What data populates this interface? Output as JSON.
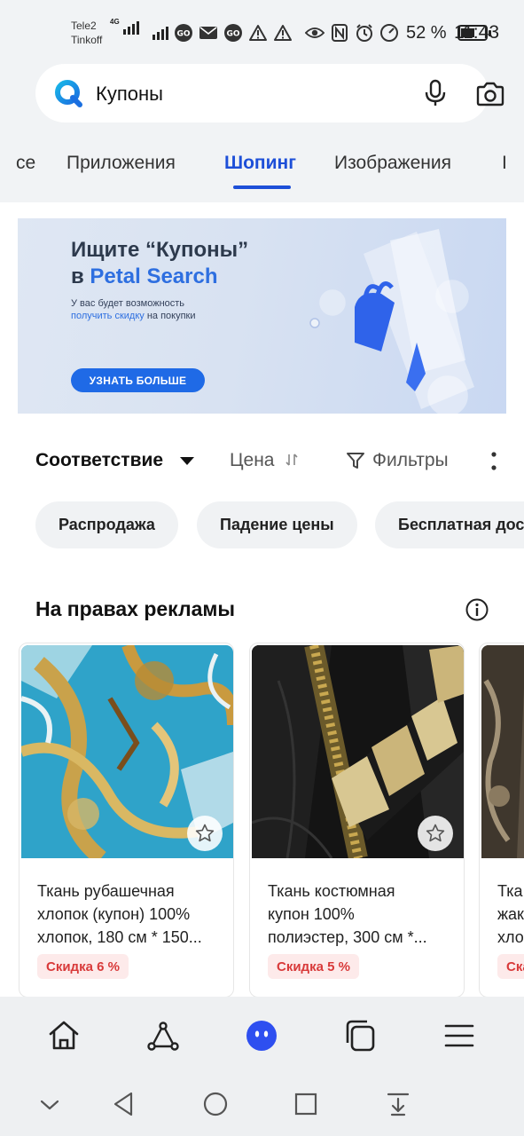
{
  "status_bar": {
    "carrier1": "Tele2",
    "carrier2": "Tinkoff",
    "network_tag": "4G",
    "battery_percent": "52 %",
    "time": "11:43"
  },
  "search": {
    "query": "Купоны"
  },
  "tabs": [
    {
      "label": "се",
      "active": false
    },
    {
      "label": "Приложения",
      "active": false
    },
    {
      "label": "Шопинг",
      "active": true
    },
    {
      "label": "Изображения",
      "active": false
    },
    {
      "label": "I",
      "active": false
    }
  ],
  "banner": {
    "title_line1": "Ищите “Купоны”",
    "title_line2_prefix": "в ",
    "title_line2_brand": "Petal Search",
    "subtitle_line1": "У вас будет возможность",
    "subtitle_link": "получить скидку",
    "subtitle_line2_suffix": " на покупки",
    "button": "УЗНАТЬ БОЛЬШЕ"
  },
  "sort": {
    "relevance": "Соответствие",
    "price": "Цена",
    "filters": "Фильтры"
  },
  "chips": [
    "Распродажа",
    "Падение цены",
    "Бесплатная доставка"
  ],
  "section": {
    "title": "На правах рекламы"
  },
  "products": [
    {
      "line1": "Ткань рубашечная",
      "line2": "хлопок (купон) 100%",
      "line3": "хлопок, 180 см * 150...",
      "discount": "Скидка 6 %"
    },
    {
      "line1": "Ткань костюмная",
      "line2": "купон 100%",
      "line3": "полиэстер, 300 см *...",
      "discount": "Скидка 5 %"
    },
    {
      "line1": "Тка",
      "line2": "жак",
      "line3": "хло",
      "discount": "Ска"
    }
  ],
  "colors": {
    "accent": "#1d4fd8",
    "discount_text": "#d83a3a",
    "discount_bg": "#fdeaea"
  }
}
